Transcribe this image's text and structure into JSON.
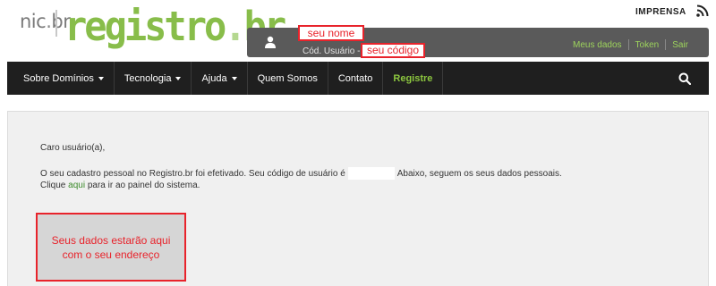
{
  "header": {
    "logo_nic": "nic",
    "logo_nic_dot": ".",
    "logo_nic_br": "br",
    "logo_registro": "registro",
    "logo_dot": ".",
    "logo_br": "br",
    "imprensa_label": "IMPRENSA",
    "rss_icon": "rss-icon"
  },
  "userbar": {
    "user_icon": "user-icon",
    "name_placeholder": "seu nome",
    "code_label": "Cód. Usuário -",
    "code_placeholder": "seu código",
    "links": [
      "Meus dados",
      "Token",
      "Sair"
    ]
  },
  "nav": {
    "items": [
      {
        "label": "Sobre Domínios",
        "dropdown": true
      },
      {
        "label": "Tecnologia",
        "dropdown": true
      },
      {
        "label": "Ajuda",
        "dropdown": true
      },
      {
        "label": "Quem Somos",
        "dropdown": false
      },
      {
        "label": "Contato",
        "dropdown": false
      },
      {
        "label": "Registre",
        "dropdown": false
      }
    ],
    "search_icon": "search-icon"
  },
  "content": {
    "greeting": "Caro usuário(a),",
    "line1_before": "O seu cadastro pessoal no Registro.br foi efetivado. Seu código de usuário é",
    "line1_after": "Abaixo, seguem os seus dados pessoais.",
    "line2_before": "Clique",
    "line2_link": "aqui",
    "line2_after": "para ir ao painel do sistema.",
    "data_box_line1": "Seus dados estarão aqui",
    "data_box_line2": "com o seu endereço"
  },
  "colors": {
    "brand_green": "#88bd4a",
    "highlight_red": "#e8232b",
    "nav_background": "#1f1f1f",
    "userbar_background": "#5a5a5a"
  }
}
